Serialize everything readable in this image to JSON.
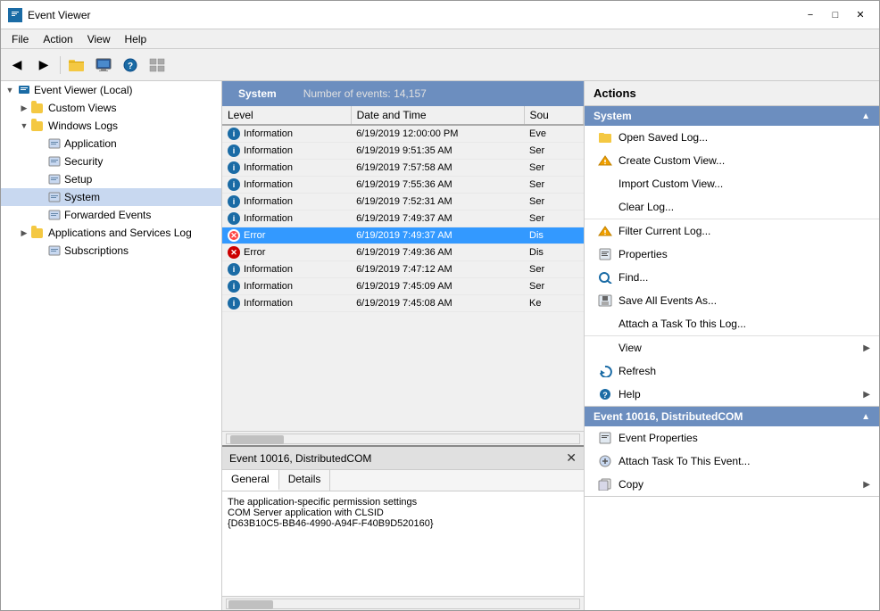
{
  "window": {
    "title": "Event Viewer",
    "icon": "EV"
  },
  "menu": {
    "items": [
      "File",
      "Action",
      "View",
      "Help"
    ]
  },
  "toolbar": {
    "buttons": [
      "◀",
      "▶",
      "📁",
      "🖥",
      "❓",
      "▦"
    ]
  },
  "sidebar": {
    "items": [
      {
        "id": "root",
        "label": "Event Viewer (Local)",
        "level": 0,
        "expand": "▼",
        "type": "root"
      },
      {
        "id": "custom-views",
        "label": "Custom Views",
        "level": 1,
        "expand": "▶",
        "type": "folder"
      },
      {
        "id": "windows-logs",
        "label": "Windows Logs",
        "level": 1,
        "expand": "▼",
        "type": "folder"
      },
      {
        "id": "application",
        "label": "Application",
        "level": 2,
        "expand": "",
        "type": "log"
      },
      {
        "id": "security",
        "label": "Security",
        "level": 2,
        "expand": "",
        "type": "log"
      },
      {
        "id": "setup",
        "label": "Setup",
        "level": 2,
        "expand": "",
        "type": "log"
      },
      {
        "id": "system",
        "label": "System",
        "level": 2,
        "expand": "",
        "type": "log",
        "selected": true
      },
      {
        "id": "forwarded-events",
        "label": "Forwarded Events",
        "level": 2,
        "expand": "",
        "type": "log"
      },
      {
        "id": "apps-services",
        "label": "Applications and Services Log",
        "level": 1,
        "expand": "▶",
        "type": "folder"
      },
      {
        "id": "subscriptions",
        "label": "Subscriptions",
        "level": 1,
        "expand": "",
        "type": "log"
      }
    ]
  },
  "event_list": {
    "tab_label": "System",
    "event_count": "Number of events: 14,157",
    "columns": [
      "Level",
      "Date and Time",
      "Sou"
    ],
    "rows": [
      {
        "id": 1,
        "level": "Information",
        "level_type": "info",
        "datetime": "6/19/2019 12:00:00 PM",
        "source": "Eve",
        "selected": false
      },
      {
        "id": 2,
        "level": "Information",
        "level_type": "info",
        "datetime": "6/19/2019 9:51:35 AM",
        "source": "Ser",
        "selected": false
      },
      {
        "id": 3,
        "level": "Information",
        "level_type": "info",
        "datetime": "6/19/2019 7:57:58 AM",
        "source": "Ser",
        "selected": false
      },
      {
        "id": 4,
        "level": "Information",
        "level_type": "info",
        "datetime": "6/19/2019 7:55:36 AM",
        "source": "Ser",
        "selected": false
      },
      {
        "id": 5,
        "level": "Information",
        "level_type": "info",
        "datetime": "6/19/2019 7:52:31 AM",
        "source": "Ser",
        "selected": false
      },
      {
        "id": 6,
        "level": "Information",
        "level_type": "info",
        "datetime": "6/19/2019 7:49:37 AM",
        "source": "Ser",
        "selected": false
      },
      {
        "id": 7,
        "level": "Error",
        "level_type": "error",
        "datetime": "6/19/2019 7:49:37 AM",
        "source": "Dis",
        "selected": true
      },
      {
        "id": 8,
        "level": "Error",
        "level_type": "error",
        "datetime": "6/19/2019 7:49:36 AM",
        "source": "Dis",
        "selected": false
      },
      {
        "id": 9,
        "level": "Information",
        "level_type": "info",
        "datetime": "6/19/2019 7:47:12 AM",
        "source": "Ser",
        "selected": false
      },
      {
        "id": 10,
        "level": "Information",
        "level_type": "info",
        "datetime": "6/19/2019 7:45:09 AM",
        "source": "Ser",
        "selected": false
      },
      {
        "id": 11,
        "level": "Information",
        "level_type": "info",
        "datetime": "6/19/2019 7:45:08 AM",
        "source": "Ke",
        "selected": false
      }
    ]
  },
  "event_detail": {
    "title": "Event 10016, DistributedCOM",
    "tabs": [
      "General",
      "Details"
    ],
    "active_tab": "General",
    "content": "The application-specific permission settings\nCOM Server application with CLSID\n{D63B10C5-BB46-4990-A94F-F40B9D520160}"
  },
  "actions": {
    "header": "Actions",
    "sections": [
      {
        "id": "system-section",
        "label": "System",
        "collapsed": false,
        "items": [
          {
            "id": "open-saved-log",
            "label": "Open Saved Log...",
            "icon": "folder",
            "has_arrow": false
          },
          {
            "id": "create-custom-view",
            "label": "Create Custom View...",
            "icon": "filter",
            "has_arrow": false
          },
          {
            "id": "import-custom-view",
            "label": "Import Custom View...",
            "icon": "none",
            "has_arrow": false
          },
          {
            "id": "clear-log",
            "label": "Clear Log...",
            "icon": "none",
            "has_arrow": false
          },
          {
            "id": "filter-current-log",
            "label": "Filter Current Log...",
            "icon": "filter",
            "has_arrow": false
          },
          {
            "id": "properties",
            "label": "Properties",
            "icon": "properties",
            "has_arrow": false
          },
          {
            "id": "find",
            "label": "Find...",
            "icon": "find",
            "has_arrow": false
          },
          {
            "id": "save-all-events",
            "label": "Save All Events As...",
            "icon": "save",
            "has_arrow": false
          },
          {
            "id": "attach-task-log",
            "label": "Attach a Task To this Log...",
            "icon": "none",
            "has_arrow": false
          },
          {
            "id": "view",
            "label": "View",
            "icon": "none",
            "has_arrow": true
          },
          {
            "id": "refresh",
            "label": "Refresh",
            "icon": "refresh",
            "has_arrow": false
          },
          {
            "id": "help",
            "label": "Help",
            "icon": "help",
            "has_arrow": true
          }
        ]
      },
      {
        "id": "event-section",
        "label": "Event 10016, DistributedCOM",
        "collapsed": false,
        "items": [
          {
            "id": "event-properties",
            "label": "Event Properties",
            "icon": "event-prop",
            "has_arrow": false
          },
          {
            "id": "attach-task-event",
            "label": "Attach Task To This Event...",
            "icon": "attach",
            "has_arrow": false
          },
          {
            "id": "copy",
            "label": "Copy",
            "icon": "copy",
            "has_arrow": true
          }
        ]
      }
    ]
  }
}
